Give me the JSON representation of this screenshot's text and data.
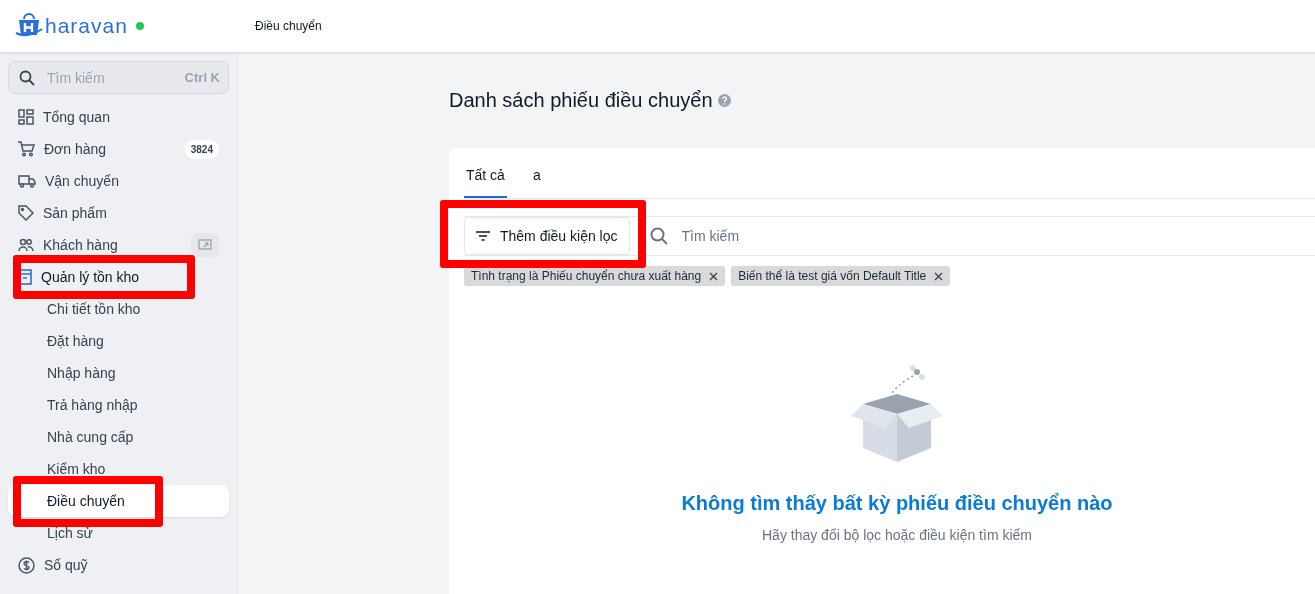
{
  "header": {
    "logo_text": "haravan",
    "online": true,
    "page_title": "Điều chuyển"
  },
  "sidebar": {
    "search": {
      "placeholder": "Tìm kiếm",
      "shortcut": "Ctrl K"
    },
    "items": [
      {
        "label": "Tổng quan",
        "selected": false,
        "highlighted": false
      },
      {
        "label": "Đơn hàng",
        "badge": "3824",
        "selected": false,
        "highlighted": false
      },
      {
        "label": "Vận chuyển",
        "selected": false,
        "highlighted": false
      },
      {
        "label": "Sản phẩm",
        "selected": false,
        "highlighted": false
      },
      {
        "label": "Khách hàng",
        "selected": false,
        "highlighted": false,
        "has_action": true
      },
      {
        "label": "Quản lý tồn kho",
        "selected": false,
        "highlighted": true,
        "expanded": true,
        "children": [
          {
            "label": "Chi tiết tồn kho",
            "selected": false,
            "highlighted": false
          },
          {
            "label": "Đặt hàng",
            "selected": false,
            "highlighted": false
          },
          {
            "label": "Nhập hàng",
            "selected": false,
            "highlighted": false
          },
          {
            "label": "Trả hàng nhập",
            "selected": false,
            "highlighted": false
          },
          {
            "label": "Nhà cung cấp",
            "selected": false,
            "highlighted": false
          },
          {
            "label": "Kiểm kho",
            "selected": false,
            "highlighted": false
          },
          {
            "label": "Điều chuyển",
            "selected": true,
            "highlighted": true
          },
          {
            "label": "Lịch sử",
            "selected": false,
            "highlighted": false
          }
        ]
      },
      {
        "label": "Sổ quỹ",
        "selected": false,
        "highlighted": false
      }
    ]
  },
  "main": {
    "title": "Danh sách phiếu điều chuyển",
    "tabs": [
      {
        "label": "Tất cả",
        "selected": true
      },
      {
        "label": "a",
        "selected": false
      }
    ],
    "filter_button": {
      "label": "Thêm điều kiện lọc",
      "highlighted": true
    },
    "search": {
      "placeholder": "Tìm kiếm"
    },
    "chips": [
      {
        "label": "Tình trạng là Phiếu chuyển chưa xuất hàng"
      },
      {
        "label": "Biến thể là test giá vốn Default Title"
      }
    ],
    "empty_state": {
      "title": "Không tìm thấy bất kỳ phiếu điều chuyển nào",
      "subtitle": "Hãy thay đổi bộ lọc hoặc điều kiện tìm kiếm"
    }
  }
}
